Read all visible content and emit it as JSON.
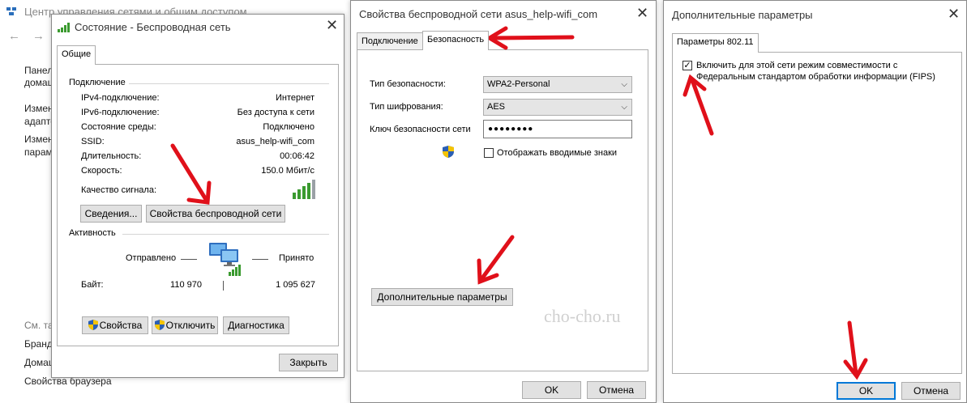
{
  "background_window": {
    "title": "Центр управления сетями и общим доступом",
    "side_links": [
      "Панел",
      "домаш",
      "Измен",
      "адапте",
      "Измен",
      "парамe"
    ],
    "bottom_links": [
      "См. та",
      "Бранд",
      "Домаш",
      "Свойства браузера"
    ]
  },
  "status_dialog": {
    "title": "Состояние - Беспроводная сеть",
    "tab": "Общие",
    "connection_header": "Подключение",
    "rows": [
      {
        "label": "IPv4-подключение:",
        "value": "Интернет"
      },
      {
        "label": "IPv6-подключение:",
        "value": "Без доступа к сети"
      },
      {
        "label": "Состояние среды:",
        "value": "Подключено"
      },
      {
        "label": "SSID:",
        "value": "asus_help-wifi_com"
      },
      {
        "label": "Длительность:",
        "value": "00:06:42"
      },
      {
        "label": "Скорость:",
        "value": "150.0 Мбит/с"
      }
    ],
    "signal_label": "Качество сигнала:",
    "details_button": "Сведения...",
    "wireless_props_button": "Свойства беспроводной сети",
    "activity_header": "Активность",
    "sent_label": "Отправлено",
    "received_label": "Принято",
    "bytes_label": "Байт:",
    "bytes_sent": "110 970",
    "bytes_received": "1 095 627",
    "properties_button": "Свойства",
    "disconnect_button": "Отключить",
    "diagnostics_button": "Диагностика",
    "close_button": "Закрыть"
  },
  "wireless_props_dialog": {
    "title": "Свойства беспроводной сети asus_help-wifi_com",
    "tabs": [
      "Подключение",
      "Безопасность"
    ],
    "security_type_label": "Тип безопасности:",
    "security_type_value": "WPA2-Personal",
    "encryption_type_label": "Тип шифрования:",
    "encryption_type_value": "AES",
    "key_label": "Ключ безопасности сети",
    "key_value": "●●●●●●●●",
    "show_chars_label": "Отображать вводимые знаки",
    "advanced_button": "Дополнительные параметры",
    "ok_button": "OK",
    "cancel_button": "Отмена",
    "watermark": "cho-cho.ru"
  },
  "advanced_dialog": {
    "title": "Дополнительные параметры",
    "tab": "Параметры 802.11",
    "fips_label_line1": "Включить для этой сети режим совместимости с",
    "fips_label_line2": "Федеральным стандартом обработки информации (FIPS)",
    "fips_checked": true,
    "ok_button": "OK",
    "cancel_button": "Отмена"
  },
  "colors": {
    "annotation_arrow": "#e0101a",
    "focus_blue": "#0078d7",
    "signal_green": "#3a9a2f"
  }
}
